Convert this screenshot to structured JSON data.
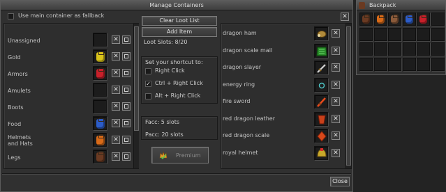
{
  "window": {
    "title": "Manage Containers",
    "close_label": "Close"
  },
  "fallback": {
    "label": "Use main container as fallback",
    "checked": false
  },
  "categories": [
    {
      "label": "Unassigned",
      "color": ""
    },
    {
      "label": "Gold",
      "color": "#d8c21a"
    },
    {
      "label": "Armors",
      "color": "#c8202a"
    },
    {
      "label": "Amulets",
      "color": ""
    },
    {
      "label": "Boots",
      "color": ""
    },
    {
      "label": "Food",
      "color": "#2c5cc8"
    },
    {
      "label": "Helmets\nand Hats",
      "color": "#d86a18"
    },
    {
      "label": "Legs",
      "color": "#6a3a22"
    }
  ],
  "middle": {
    "clear_label": "Clear Loot List",
    "add_label": "Add Item",
    "slots_label": "Loot Slots: 8/20",
    "shortcut_title": "Set your shortcut to:",
    "shortcuts": [
      {
        "label": "Right Click",
        "checked": false
      },
      {
        "label": "Ctrl + Right Click",
        "checked": true
      },
      {
        "label": "Alt + Right Click",
        "checked": false
      }
    ],
    "facc": "Facc: 5 slots",
    "pacc": "Pacc: 20 slots",
    "premium_label": "Premium"
  },
  "loot": [
    {
      "label": "dragon ham",
      "icon": "ham"
    },
    {
      "label": "dragon scale mail",
      "icon": "scale-mail"
    },
    {
      "label": "dragon slayer",
      "icon": "sword"
    },
    {
      "label": "energy ring",
      "icon": "ring"
    },
    {
      "label": "fire sword",
      "icon": "fire-sword"
    },
    {
      "label": "red dragon leather",
      "icon": "leather"
    },
    {
      "label": "red dragon scale",
      "icon": "scale"
    },
    {
      "label": "royal helmet",
      "icon": "helmet"
    }
  ],
  "backpack": {
    "title": "Backpack",
    "items": [
      "#6a3a22",
      "#d86a18",
      "#8a5a3a",
      "#2c5cc8",
      "#c8202a"
    ]
  }
}
